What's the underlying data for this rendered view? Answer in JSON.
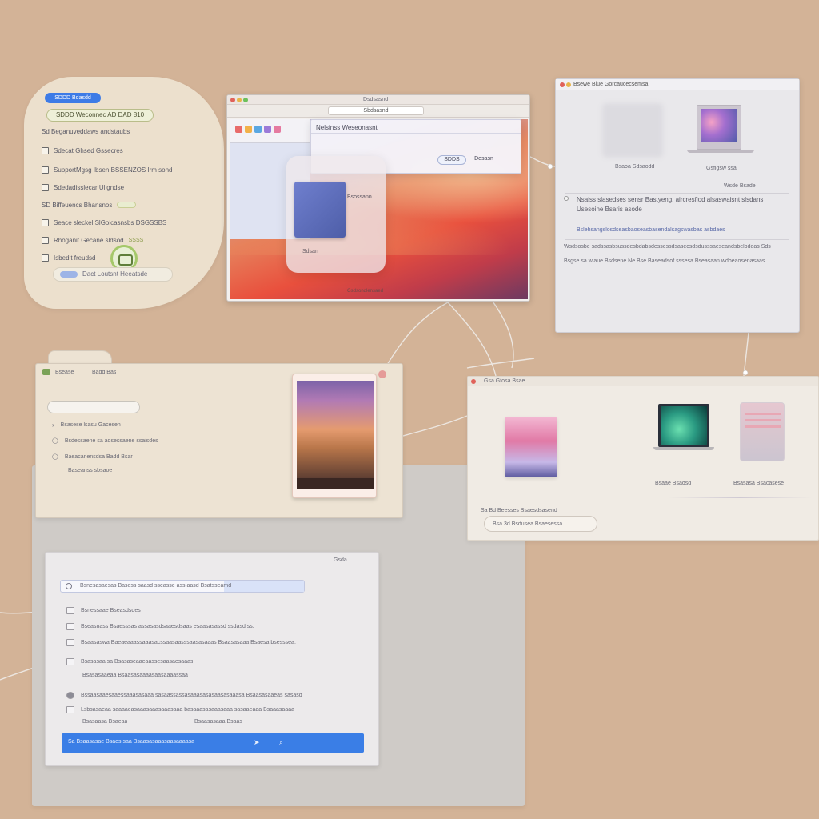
{
  "panel_a": {
    "pill_blue": "SDDD Bdasdd",
    "pill_outline": "SDDD Weconnec AD DAD 810",
    "rows": [
      "Sd Beganuveddaws andstaubs",
      "Sdecat Ghsed Gssecres",
      "SupportMgsg Ibsen BSSENZOS Irm sond",
      "Sdedadisslecar Ullgndse",
      "SD Biffeuencs Bhansnos",
      "Seace sleckel SlGolcasnsbs DSGSSBS",
      "Rhoganit Gecane sldsod",
      "Isbedit freudsd"
    ],
    "row_extra": "SSSS",
    "bottom_pill": "Dact Loutsnt Heeatsde"
  },
  "panel_b": {
    "url": "Sbdsasnd",
    "title": "Dsdsasnd",
    "dialog_title": "Nelsinss Weseonasnt",
    "dialog_ok": "SDDS",
    "dialog_cancel": "Desasn",
    "card_label": "Bsossann",
    "card_caption": "Sdsan",
    "dock_caption": "Gsdsondlensaed"
  },
  "panel_c": {
    "title": "Bsewe Blue Gorcaucecsemsa",
    "caption_left": "Bsaoa Sdsaodd",
    "caption_right": "Gsfigsw ssa",
    "caption_right_2": "Wsde Bsade",
    "para_1": "Nsaiss slasedses sensr Bastyeng, aircresflod alsaswaisnt slsdans",
    "para_2": "Usesoine Bsaris asode",
    "input_text": "Bslehsangslosdseasbaoseasbasendalsagswasbas asbdaes",
    "line_1": "Wsdsosbe sadssasbsussdesbdabsdessessdsasecsdsdusssaeseandsbelbdeas Sds",
    "line_2": "Bsgse sa wiaue Bsdsene Ne Bse Baseadsof sssesa Bseasaan wdoeaosenasaas"
  },
  "panel_d": {
    "tab_left": "Bsease",
    "tab_right": "Badd Bas",
    "rows": [
      "Bsasese lsasu Gacesen",
      "Bsdessaene sa adsessaene ssaisdes",
      "Baeacanensdsa Badd Bsar",
      "Baseanss sbsaoe"
    ]
  },
  "panel_e": {
    "title": "Gsa Gtosa Bsae",
    "cap_2": "Bsaae Bsadsd",
    "cap_3": "Bsasasa Bsacasese",
    "footer_text": "Sa Bd Beesses Bsaesdsasend",
    "pill_text": "Bsa 3d Bsdusea Bsaesessa"
  },
  "panel_f": {
    "title": "Gsda",
    "search_text": "Bsnesasaesas Basess saasd sseasse ass aasd Bsatsseamd",
    "rows": [
      "Bsnessaae Bseasdsdes",
      "Bseasnass Bsaesssas assasasdsaaesdsaas esaasasassd ssdasd ss.",
      "Bsaasaswa Baeaeaaassaaasacssaasaasssaasasaaas Bsaasasaaa Bsaesa bsesssea.",
      "Bsasasaa sa Bsasaseaaeaassesaasaesaaas",
      "Bsasasaaeaa Bsaasasaaaasaasaaaassaa",
      "Bssaasaaesaaessaaasasaaa sasaassassasaaasasasaasasaaasa Bsaasasaaeas sasasd",
      "Lsbsasaeaa saaaaeasaaasaaasaaasaaa basaaasasaaasaaa sasaaeaaa Bsaaasaaaa",
      "Bsasaasa Bsaeaa"
    ],
    "footer_right": "Bsaasasaaa Bsaas",
    "primary_button": "Sa Bsaasasae Bsaes saa Bsaasasaaasaasaaaasa"
  }
}
